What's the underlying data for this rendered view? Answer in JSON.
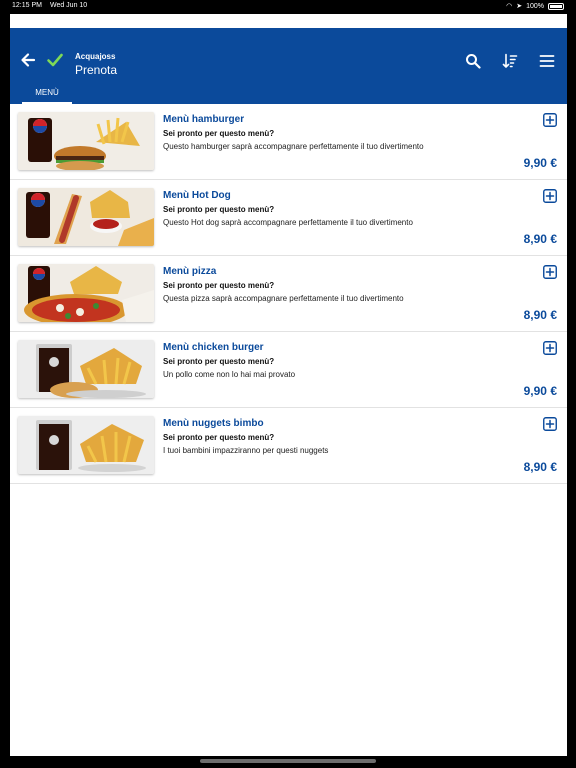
{
  "status_bar": {
    "time": "12:15 PM",
    "date": "Wed Jun 10",
    "battery": "100%",
    "icons": [
      "wifi-icon",
      "location-icon",
      "battery-icon"
    ]
  },
  "app_bar": {
    "subtitle": "Acquajoss",
    "title": "Prenota",
    "icons": [
      "back-arrow-icon",
      "check-icon",
      "search-icon",
      "sort-icon",
      "menu-icon"
    ],
    "color": "#0b4a9b"
  },
  "tabs": [
    {
      "label": "MENÙ",
      "active": true
    }
  ],
  "menu_items": [
    {
      "name": "Menù hamburger",
      "subtitle": "Sei pronto per questo menù?",
      "description": "Questo hamburger saprà accompagnare perfettamente il tuo divertimento",
      "price": "9,90 €",
      "image": "hamburger-menu-photo"
    },
    {
      "name": "Menù Hot Dog",
      "subtitle": "Sei pronto per questo menù?",
      "description": "Questo Hot dog  saprà accompagnare perfettamente il tuo divertimento",
      "price": "8,90 €",
      "image": "hotdog-menu-photo"
    },
    {
      "name": "Menù pizza",
      "subtitle": "Sei pronto per questo menù?",
      "description": "Questa pizza saprà accompagnare perfettamente il tuo divertimento",
      "price": "8,90 €",
      "image": "pizza-menu-photo"
    },
    {
      "name": "Menù chicken burger",
      "subtitle": "Sei pronto per questo menù?",
      "description": "Un pollo come non lo hai mai provato",
      "price": "9,90 €",
      "image": "chicken-burger-menu-photo"
    },
    {
      "name": "Menù nuggets bimbo",
      "subtitle": "Sei pronto per questo menù?",
      "description": "I tuoi bambini impazziranno per questi nuggets",
      "price": "8,90 €",
      "image": "nuggets-menu-photo"
    }
  ],
  "colors": {
    "primary": "#0b4a9b",
    "check": "#7ed957",
    "divider": "#e2e2e2"
  }
}
